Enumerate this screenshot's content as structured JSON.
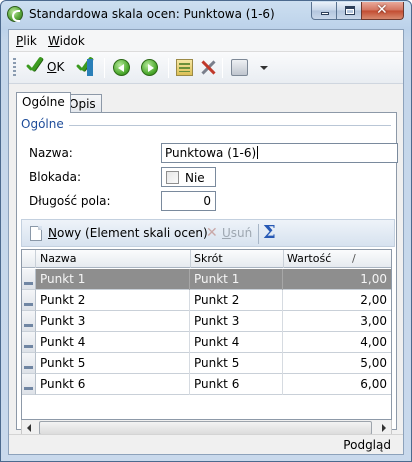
{
  "window": {
    "title": "Standardowa skala ocen: Punktowa (1-6)",
    "caption_buttons": [
      "minimize-icon",
      "maximize-icon",
      "close-icon"
    ]
  },
  "menu": {
    "items": [
      {
        "label": "Plik",
        "underline": "P",
        "rest": "lik"
      },
      {
        "label": "Widok",
        "underline": "W",
        "rest": "idok"
      }
    ]
  },
  "toolbar": {
    "ok_underline": "O",
    "ok_rest": "K",
    "icons": [
      "check-icon",
      "check-save-icon",
      "prev-icon",
      "next-icon",
      "tree-icon",
      "tools-icon",
      "print-icon",
      "dropdown-arrow-icon"
    ]
  },
  "tabs": [
    {
      "label": "Ogólne",
      "active": true
    },
    {
      "label": "Opis",
      "active": false
    }
  ],
  "form": {
    "group_title": "Ogólne",
    "nazwa_label": "Nazwa:",
    "nazwa_value": "Punktowa (1-6)",
    "blokada_label": "Blokada:",
    "blokada_checked": false,
    "blokada_text": "Nie",
    "dlugosc_label": "Długość pola:",
    "dlugosc_value": "0"
  },
  "grid_toolbar": {
    "new_underline": "N",
    "new_rest": "owy (Element skali ocen)",
    "delete_underline": "U",
    "delete_rest": "suń",
    "delete_enabled": false,
    "sum_icon": "sigma-icon"
  },
  "grid": {
    "columns": [
      "Nazwa",
      "Skrót",
      "Wartość"
    ],
    "sort_indicator": "/",
    "rows": [
      {
        "nazwa": "Punkt 1",
        "skrot": "Punkt 1",
        "wartosc": "1,00",
        "selected": true
      },
      {
        "nazwa": "Punkt 2",
        "skrot": "Punkt 2",
        "wartosc": "2,00",
        "selected": false
      },
      {
        "nazwa": "Punkt 3",
        "skrot": "Punkt 3",
        "wartosc": "3,00",
        "selected": false
      },
      {
        "nazwa": "Punkt 4",
        "skrot": "Punkt 4",
        "wartosc": "4,00",
        "selected": false
      },
      {
        "nazwa": "Punkt 5",
        "skrot": "Punkt 5",
        "wartosc": "5,00",
        "selected": false
      },
      {
        "nazwa": "Punkt 6",
        "skrot": "Punkt 6",
        "wartosc": "6,00",
        "selected": false
      }
    ]
  },
  "status": {
    "right_text": "Podgląd"
  },
  "colors": {
    "selected_row": "#8e8e8e",
    "group_title": "#1f4d9a",
    "ok_green": "#3b9a1f"
  }
}
